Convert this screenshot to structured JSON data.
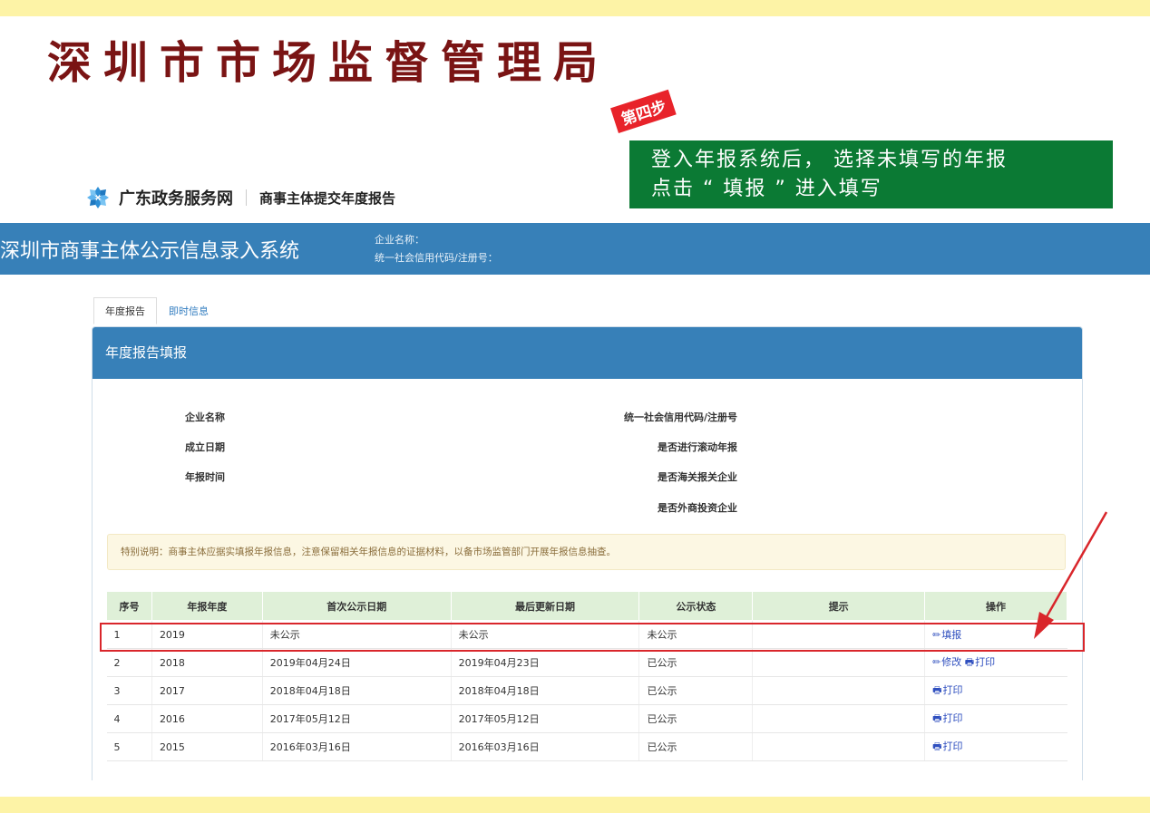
{
  "slide": {
    "title": "深圳市市场监督管理局",
    "step_badge": "第四步",
    "step_line1": "登入年报系统后， 选择未填写的年报",
    "step_line2": "点击 “ 填报 ” 进入填写",
    "accent_color": "#7a1414",
    "annotation_color": "#d9262b",
    "note_color": "#0b7a34"
  },
  "portal": {
    "logo_icon": "guangdong-portal-logo-icon",
    "name": "广东政务服务网",
    "subtitle": "商事主体提交年度报告"
  },
  "system": {
    "title": "深圳市商事主体公示信息录入系统",
    "company_label": "企业名称：",
    "credit_label": "统一社会信用代码/注册号："
  },
  "tabs": [
    "年度报告",
    "即时信息"
  ],
  "panel": {
    "title": "年度报告填报",
    "labels_left": [
      "企业名称",
      "成立日期",
      "年报时间"
    ],
    "labels_right": [
      "统一社会信用代码/注册号",
      "是否进行滚动年报",
      "是否海关报关企业",
      "是否外商投资企业"
    ],
    "notice": "特别说明：商事主体应据实填报年报信息，注意保留相关年报信息的证据材料，以备市场监管部门开展年报信息抽查。"
  },
  "table": {
    "headers": [
      "序号",
      "年报年度",
      "首次公示日期",
      "最后更新日期",
      "公示状态",
      "提示",
      "操作"
    ],
    "rows": [
      {
        "no": "1",
        "year": "2019",
        "first": "未公示",
        "last": "未公示",
        "status": "未公示",
        "hint": "",
        "ops": [
          {
            "icon": "pencil-icon",
            "label": "填报"
          }
        ]
      },
      {
        "no": "2",
        "year": "2018",
        "first": "2019年04月24日",
        "last": "2019年04月23日",
        "status": "已公示",
        "hint": "",
        "ops": [
          {
            "icon": "pencil-icon",
            "label": "修改"
          },
          {
            "icon": "printer-icon",
            "label": "打印"
          }
        ]
      },
      {
        "no": "3",
        "year": "2017",
        "first": "2018年04月18日",
        "last": "2018年04月18日",
        "status": "已公示",
        "hint": "",
        "ops": [
          {
            "icon": "printer-icon",
            "label": "打印"
          }
        ]
      },
      {
        "no": "4",
        "year": "2016",
        "first": "2017年05月12日",
        "last": "2017年05月12日",
        "status": "已公示",
        "hint": "",
        "ops": [
          {
            "icon": "printer-icon",
            "label": "打印"
          }
        ]
      },
      {
        "no": "5",
        "year": "2015",
        "first": "2016年03月16日",
        "last": "2016年03月16日",
        "status": "已公示",
        "hint": "",
        "ops": [
          {
            "icon": "printer-icon",
            "label": "打印"
          }
        ]
      }
    ]
  }
}
